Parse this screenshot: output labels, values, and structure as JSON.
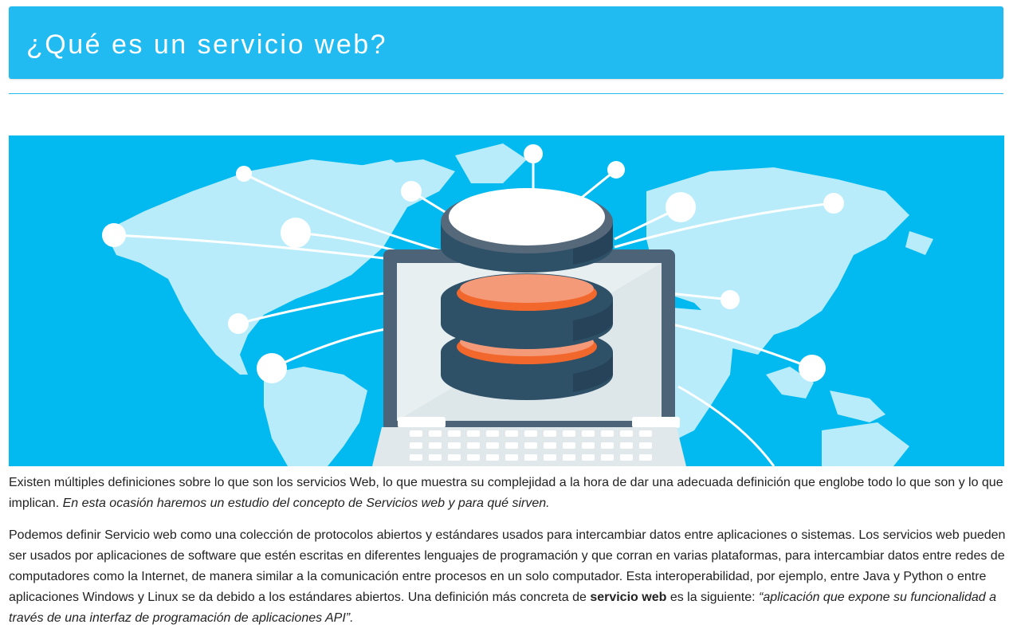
{
  "page": {
    "title": "¿Qué es un servicio web?"
  },
  "hero_image": {
    "icon": "database-laptop-world-map-illustration",
    "colors": {
      "background": "#02baef",
      "continents": "#b8ecfb",
      "db_dark": "#2f5168",
      "db_accent": "#f2672c"
    }
  },
  "article": {
    "p1_text": "Existen múltiples definiciones sobre lo que son los servicios Web, lo que muestra su complejidad a la hora de dar una adecuada definición que englobe todo lo que son y lo que implican.",
    "p1_emphasis": "En esta ocasión haremos un estudio del concepto de Servicios web y para qué sirven.",
    "p2_text": "Podemos definir Servicio web como una colección de protocolos abiertos y estándares usados para intercambiar datos entre aplicaciones o sistemas. Los servicios web pueden ser usados por aplicaciones de software que estén escritas en diferentes lenguajes de programación y que corran en varias plataformas, para intercambiar datos entre redes de computadores como la Internet, de manera similar a la comunicación entre procesos en un solo computador. Esta interoperabilidad, por ejemplo, entre Java y Python o entre aplicaciones Windows y Linux se da debido a los estándares abiertos. Una definición más concreta de",
    "p2_bold": "servicio web",
    "p2_after": "es la siguiente:",
    "p2_quote": "“aplicación que expone su funcionalidad a través de una interfaz de programación de aplicaciones API”."
  }
}
